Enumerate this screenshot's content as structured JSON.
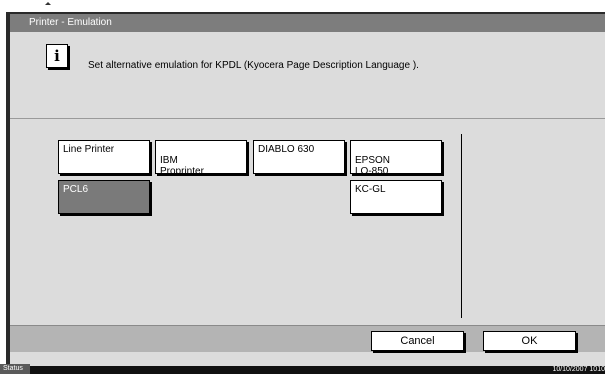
{
  "window": {
    "title": "Printer - Emulation"
  },
  "info": {
    "icon": "info-icon",
    "message": "Set alternative emulation for KPDL (Kyocera Page Description Language )."
  },
  "options": [
    {
      "label": "Line Printer",
      "selected": false
    },
    {
      "label": "IBM\nProprinter",
      "selected": false
    },
    {
      "label": "DIABLO 630",
      "selected": false
    },
    {
      "label": "EPSON\nLQ-850",
      "selected": false
    },
    {
      "label": "PCL6",
      "selected": true
    },
    {
      "label": "KC-GL",
      "selected": false
    }
  ],
  "footer": {
    "cancel_label": "Cancel",
    "ok_label": "OK"
  },
  "status_bar": {
    "status_label": "Status",
    "datetime": "10/10/2007   1010"
  },
  "colors": {
    "selected_bg": "#7a7a7a",
    "panel_bg": "#dcdcdc",
    "titlebar_bg": "#7d7d7d"
  }
}
